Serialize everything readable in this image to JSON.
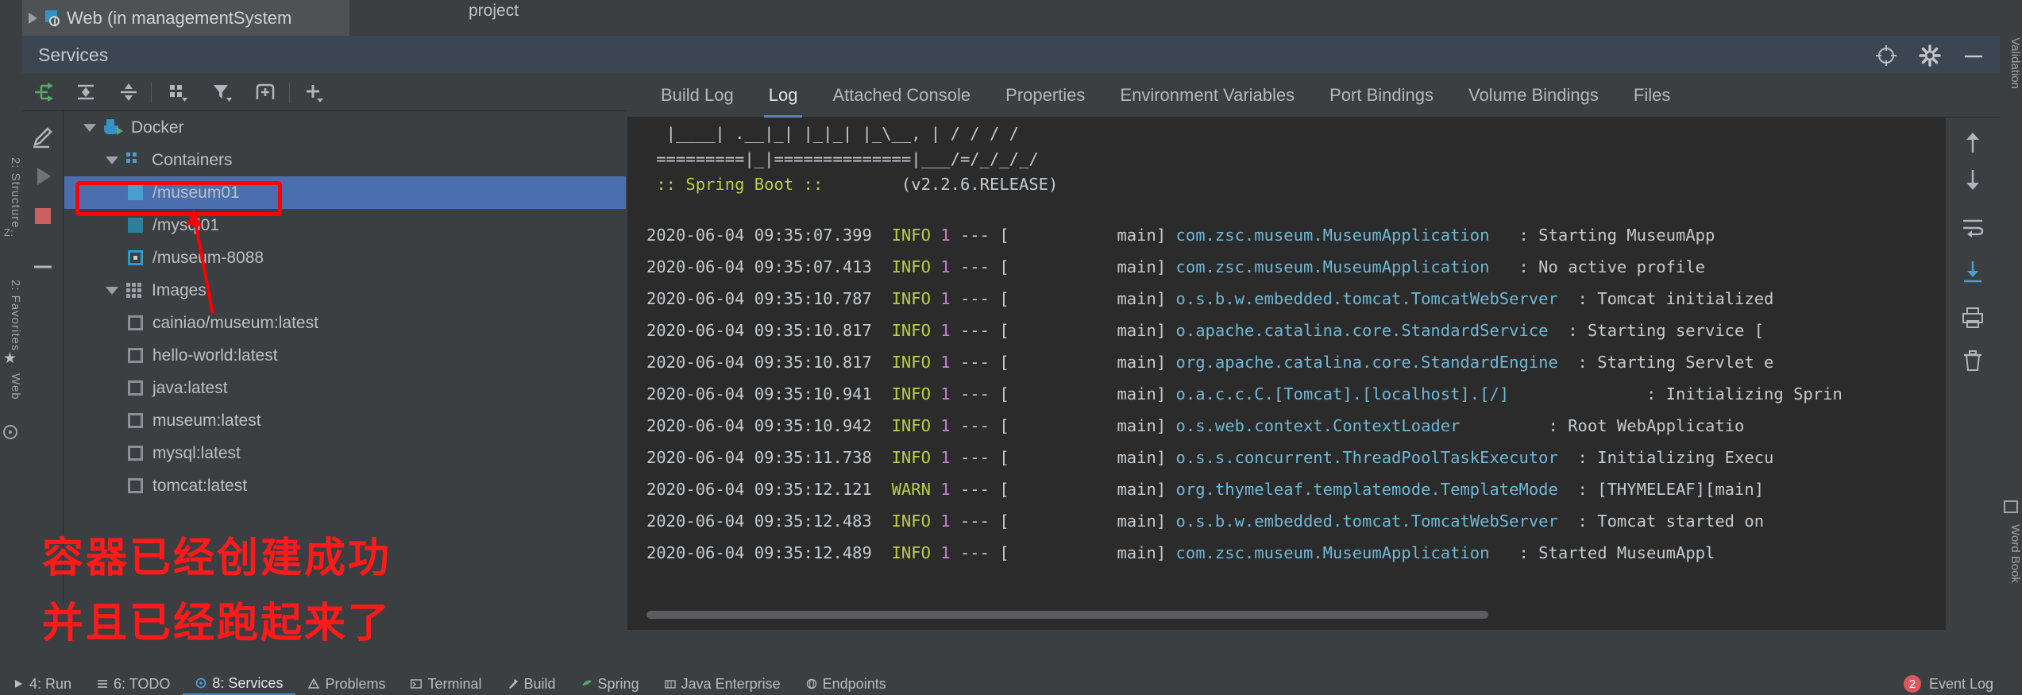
{
  "window": {
    "web_tab_label": "Web (in managementSystem",
    "project_label": "project",
    "services_title": "Services"
  },
  "services_toolbar": {
    "buttons": [
      {
        "name": "run-configuration-icon",
        "label": "Run"
      },
      {
        "name": "expand-all-icon",
        "label": "Expand All"
      },
      {
        "name": "collapse-all-icon",
        "label": "Collapse All"
      },
      {
        "name": "group-by-icon",
        "label": "Group By"
      },
      {
        "name": "filter-icon",
        "label": "Filter"
      },
      {
        "name": "add-tab-icon",
        "label": "Add Tab"
      },
      {
        "name": "add-service-icon",
        "label": "Add Service"
      }
    ]
  },
  "run_rail": {
    "buttons": [
      {
        "name": "edit-configuration-icon",
        "label": "Edit Configuration"
      },
      {
        "name": "run-icon",
        "label": "Run"
      },
      {
        "name": "stop-icon",
        "label": "Stop"
      },
      {
        "name": "minus-icon",
        "label": "Remove"
      }
    ]
  },
  "tree": {
    "root": {
      "label": "Docker",
      "icon": "docker-icon"
    },
    "containers_group": {
      "label": "Containers",
      "icon": "containers-grid-icon"
    },
    "containers": [
      {
        "label": "/museum01",
        "icon": "container-running-icon",
        "selected": true
      },
      {
        "label": "/mysql01",
        "icon": "container-running-icon",
        "selected": false
      },
      {
        "label": "/museum-8088",
        "icon": "container-stopped-icon",
        "selected": false
      }
    ],
    "images_group": {
      "label": "Images",
      "icon": "images-grid-icon"
    },
    "images": [
      {
        "label": "cainiao/museum:latest",
        "icon": "image-icon"
      },
      {
        "label": "hello-world:latest",
        "icon": "image-icon"
      },
      {
        "label": "java:latest",
        "icon": "image-icon"
      },
      {
        "label": "museum:latest",
        "icon": "image-icon"
      },
      {
        "label": "mysql:latest",
        "icon": "image-icon"
      },
      {
        "label": "tomcat:latest",
        "icon": "image-icon"
      }
    ]
  },
  "annotation": {
    "color": "#ff1a1a",
    "line1": "容器已经创建成功",
    "line2": "并且已经跑起来了"
  },
  "log_panel": {
    "tabs": [
      {
        "label": "Build Log",
        "active": false
      },
      {
        "label": "Log",
        "active": true
      },
      {
        "label": "Attached Console",
        "active": false
      },
      {
        "label": "Properties",
        "active": false
      },
      {
        "label": "Environment Variables",
        "active": false
      },
      {
        "label": "Port Bindings",
        "active": false
      },
      {
        "label": "Volume Bindings",
        "active": false
      },
      {
        "label": "Files",
        "active": false
      }
    ],
    "tools": [
      {
        "name": "scroll-up-icon",
        "label": "Up"
      },
      {
        "name": "scroll-down-icon",
        "label": "Down"
      },
      {
        "name": "soft-wrap-icon",
        "label": "Soft-Wrap"
      },
      {
        "name": "scroll-to-end-icon",
        "label": "Scroll to End"
      },
      {
        "name": "print-icon",
        "label": "Print"
      },
      {
        "name": "delete-icon",
        "label": "Clear"
      }
    ],
    "banner_line1": "  |____| .__|_| |_|_| |_\\__, | / / / /",
    "banner_line2": " =========|_|==============|___/=/_/_/_/",
    "spring_boot_marker": " :: Spring Boot :: ",
    "spring_boot_version": "       (v2.2.6.RELEASE)",
    "lines": [
      {
        "timestamp": "2020-06-04 09:35:07.399",
        "level": "INFO",
        "pid": "1",
        "dash": "--- [",
        "thread": "           main]",
        "logger": "com.zsc.museum.MuseumApplication",
        "message": ": Starting MuseumApp"
      },
      {
        "timestamp": "2020-06-04 09:35:07.413",
        "level": "INFO",
        "pid": "1",
        "dash": "--- [",
        "thread": "           main]",
        "logger": "com.zsc.museum.MuseumApplication",
        "message": ": No active profile"
      },
      {
        "timestamp": "2020-06-04 09:35:10.787",
        "level": "INFO",
        "pid": "1",
        "dash": "--- [",
        "thread": "           main]",
        "logger": "o.s.b.w.embedded.tomcat.TomcatWebServer",
        "message": ": Tomcat initialized"
      },
      {
        "timestamp": "2020-06-04 09:35:10.817",
        "level": "INFO",
        "pid": "1",
        "dash": "--- [",
        "thread": "           main]",
        "logger": "o.apache.catalina.core.StandardService",
        "message": ": Starting service ["
      },
      {
        "timestamp": "2020-06-04 09:35:10.817",
        "level": "INFO",
        "pid": "1",
        "dash": "--- [",
        "thread": "           main]",
        "logger": "org.apache.catalina.core.StandardEngine",
        "message": ": Starting Servlet e"
      },
      {
        "timestamp": "2020-06-04 09:35:10.941",
        "level": "INFO",
        "pid": "1",
        "dash": "--- [",
        "thread": "           main]",
        "logger": "o.a.c.c.C.[Tomcat].[localhost].[/]",
        "message": ": Initializing Sprin"
      },
      {
        "timestamp": "2020-06-04 09:35:10.942",
        "level": "INFO",
        "pid": "1",
        "dash": "--- [",
        "thread": "           main]",
        "logger": "o.s.web.context.ContextLoader",
        "message": ": Root WebApplicatio"
      },
      {
        "timestamp": "2020-06-04 09:35:11.738",
        "level": "INFO",
        "pid": "1",
        "dash": "--- [",
        "thread": "           main]",
        "logger": "o.s.s.concurrent.ThreadPoolTaskExecutor",
        "message": ": Initializing Execu"
      },
      {
        "timestamp": "2020-06-04 09:35:12.121",
        "level": "WARN",
        "pid": "1",
        "dash": "--- [",
        "thread": "           main]",
        "logger": "org.thymeleaf.templatemode.TemplateMode",
        "message": ": [THYMELEAF][main]"
      },
      {
        "timestamp": "2020-06-04 09:35:12.483",
        "level": "INFO",
        "pid": "1",
        "dash": "--- [",
        "thread": "           main]",
        "logger": "o.s.b.w.embedded.tomcat.TomcatWebServer",
        "message": ": Tomcat started on"
      },
      {
        "timestamp": "2020-06-04 09:35:12.489",
        "level": "INFO",
        "pid": "1",
        "dash": "--- [",
        "thread": "           main]",
        "logger": "com.zsc.museum.MuseumApplication",
        "message": ": Started MuseumAppl"
      }
    ]
  },
  "status_bar": {
    "items": [
      {
        "label": "4: Run",
        "icon": "run-icon",
        "active": false
      },
      {
        "label": "6: TODO",
        "icon": "todo-icon",
        "active": false
      },
      {
        "label": "8: Services",
        "icon": "services-icon",
        "active": true
      },
      {
        "label": "Problems",
        "icon": "problems-icon",
        "active": false
      },
      {
        "label": "Terminal",
        "icon": "terminal-icon",
        "active": false
      },
      {
        "label": "Build",
        "icon": "build-icon",
        "active": false
      },
      {
        "label": "Spring",
        "icon": "spring-icon",
        "active": false
      },
      {
        "label": "Java Enterprise",
        "icon": "java-enterprise-icon",
        "active": false
      },
      {
        "label": "Endpoints",
        "icon": "endpoints-icon",
        "active": false
      }
    ],
    "event_log": {
      "label": "Event Log",
      "badge": "2"
    }
  },
  "left_rail": {
    "structure": "2: Structure",
    "z_label": "Z:",
    "favorites": "2: Favorites",
    "web": "Web"
  },
  "right_rail": {
    "bean_validation": "Bean Validation",
    "word_book": "Word Book"
  },
  "colors": {
    "selection": "#4b6eaf",
    "accent": "#4a88c7",
    "annotation_red": "#ff1a1a",
    "log_bg": "#2b2b2b",
    "panel_bg": "#3c3f41"
  }
}
